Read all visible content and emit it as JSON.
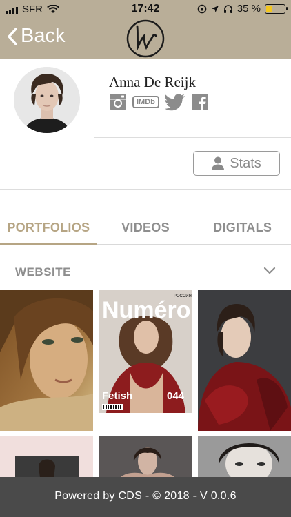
{
  "status_bar": {
    "carrier": "SFR",
    "time": "17:42",
    "battery_percent": "35 %",
    "battery_level": 0.35
  },
  "nav": {
    "back_label": "Back",
    "logo_icon": "brand-logo-w"
  },
  "profile": {
    "name": "Anna De Reijk",
    "socials": [
      {
        "icon": "instagram-icon"
      },
      {
        "icon": "imdb-icon",
        "label": "IMDb"
      },
      {
        "icon": "twitter-icon"
      },
      {
        "icon": "facebook-icon"
      }
    ],
    "stats_label": "Stats"
  },
  "tabs": [
    {
      "label": "PORTFOLIOS",
      "active": true
    },
    {
      "label": "VIDEOS",
      "active": false
    },
    {
      "label": "DIGITALS",
      "active": false
    }
  ],
  "section": {
    "label": "WEBSITE"
  },
  "grid": {
    "magazine_title": "Numéro",
    "magazine_badge": "РОССИЯ",
    "magazine_feature": "Fetish",
    "magazine_issue": "044"
  },
  "footer": {
    "text": "Powered by CDS - © 2018 - V 0.0.6"
  },
  "colors": {
    "header_bg": "#b9ae98",
    "accent": "#b6a584",
    "footer_bg": "#4a4a4a"
  }
}
